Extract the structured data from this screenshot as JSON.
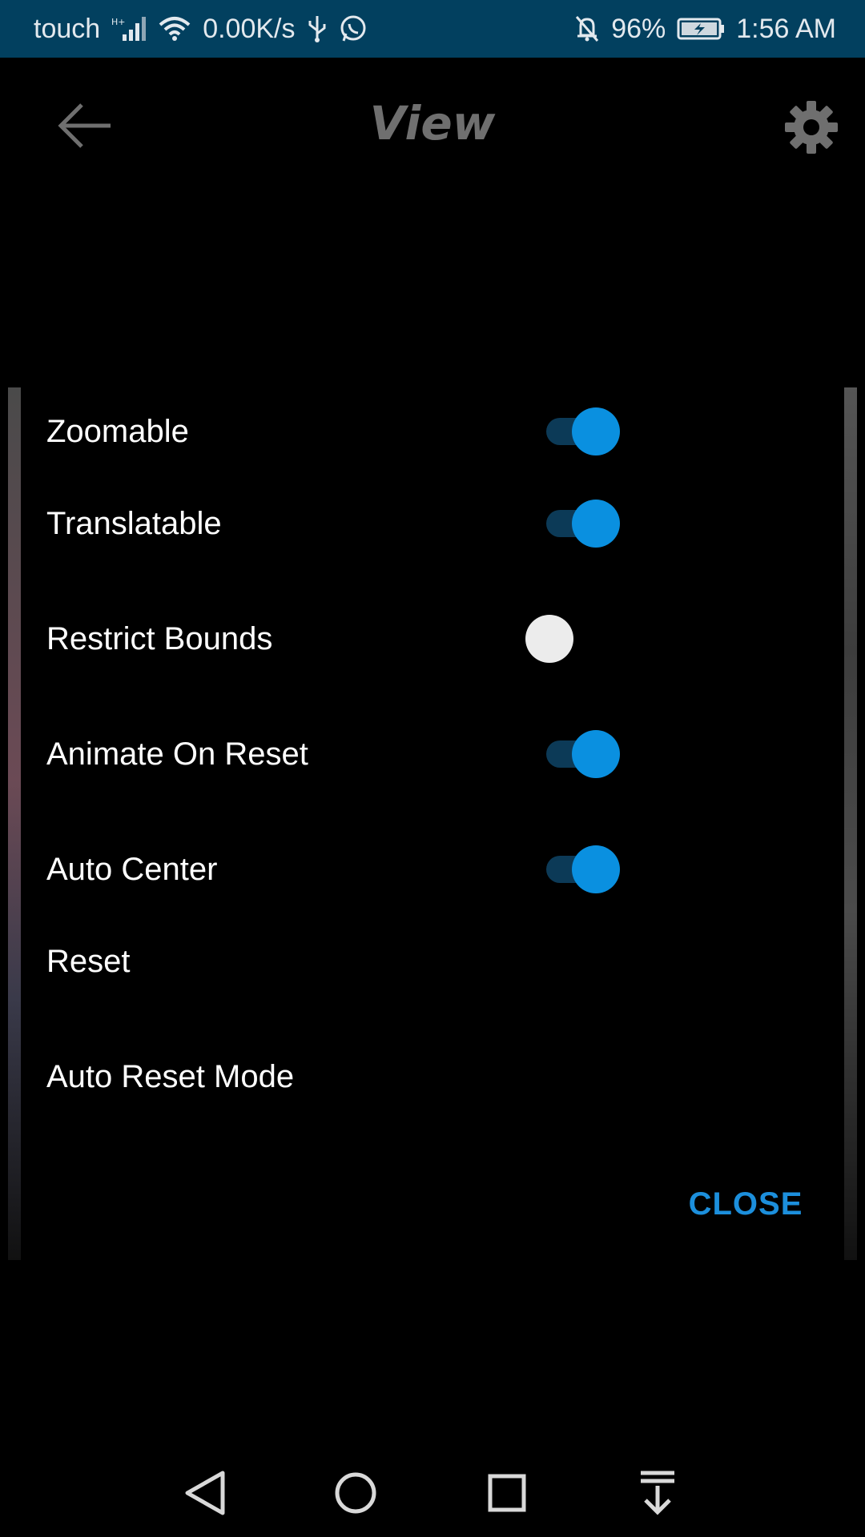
{
  "status_bar": {
    "carrier": "touch",
    "network_speed": "0.00K/s",
    "battery_percent": "96%",
    "time": "1:56 AM",
    "icons": [
      "signal-icon",
      "wifi-icon",
      "usb-icon",
      "whatsapp-icon",
      "silent-bell-icon",
      "battery-icon"
    ]
  },
  "toolbar": {
    "title": "View",
    "back_icon": "arrow-left-icon",
    "settings_icon": "gear-icon"
  },
  "dialog": {
    "options": [
      {
        "label": "Zoomable",
        "enabled": true
      },
      {
        "label": "Translatable",
        "enabled": true
      },
      {
        "label": "Restrict Bounds",
        "enabled": false
      },
      {
        "label": "Animate On Reset",
        "enabled": true
      },
      {
        "label": "Auto Center",
        "enabled": true
      },
      {
        "label": "Reset"
      },
      {
        "label": "Auto Reset Mode"
      }
    ],
    "close_label": "CLOSE"
  },
  "colors": {
    "status_bar": "#02405f",
    "accent": "#1c8fdc",
    "switch_track_on": "#0c3a57",
    "switch_thumb_on": "#0a90e0",
    "switch_thumb_off": "#ececec"
  },
  "nav_bar": {
    "icons": [
      "back-triangle-icon",
      "home-circle-icon",
      "recents-square-icon",
      "pull-down-icon"
    ]
  }
}
